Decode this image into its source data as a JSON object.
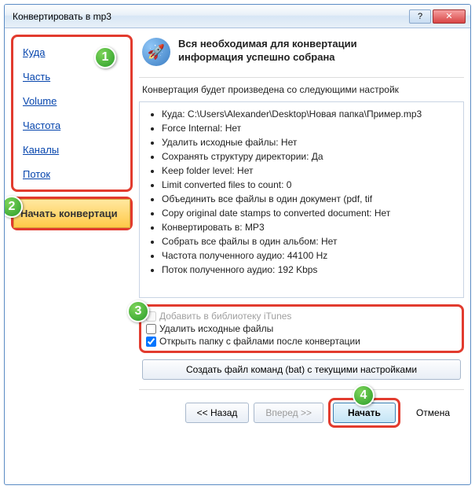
{
  "window": {
    "title": "Конвертировать в mp3"
  },
  "sidebar": {
    "items": [
      "Куда",
      "Часть",
      "Volume",
      "Частота",
      "Каналы",
      "Поток"
    ],
    "active": "Начать конвертаци"
  },
  "header": {
    "line1": "Вся необходимая для конвертации",
    "line2": "информация успешно собрана"
  },
  "intro": "Конвертация будет произведена со следующими настройк",
  "settings": [
    "Куда: C:\\Users\\Alexander\\Desktop\\Новая папка\\Пример.mp3",
    "Force Internal: Нет",
    "Удалить исходные файлы: Нет",
    "Сохранять структуру директории: Да",
    "Keep folder level: Нет",
    "Limit converted files to count: 0",
    "Объединить все файлы в один документ (pdf, tif",
    "Copy original date stamps to converted document: Нет",
    "Конвертировать в: MP3",
    "Собрать все файлы в один альбом: Нет",
    "Частота полученного аудио: 44100 Hz",
    "Поток полученного аудио: 192 Kbps"
  ],
  "checks": {
    "itunes": {
      "label": "Добавить в библиотеку iTunes",
      "checked": false,
      "disabled": true
    },
    "delete": {
      "label": "Удалить исходные файлы",
      "checked": false,
      "disabled": false
    },
    "open": {
      "label": "Открыть папку с файлами после конвертации",
      "checked": true,
      "disabled": false
    }
  },
  "batbtn": "Создать файл команд (bat) с текущими настройками",
  "nav": {
    "back": "<< Назад",
    "forward": "Вперед >>",
    "start": "Начать",
    "cancel": "Отмена"
  },
  "badges": {
    "b1": "1",
    "b2": "2",
    "b3": "3",
    "b4": "4"
  }
}
